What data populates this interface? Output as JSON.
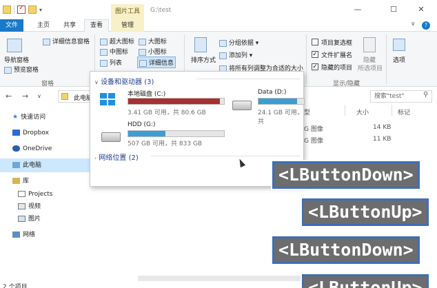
{
  "window": {
    "context_tab_header": "图片工具",
    "path_title": "G:\\test",
    "controls": [
      "—",
      "☐",
      "✕"
    ]
  },
  "tabs": {
    "file": "文件",
    "home": "主页",
    "share": "共享",
    "view": "查看",
    "manage": "管理",
    "help": "?"
  },
  "ribbon": {
    "pane_group": {
      "nav_pane": "导航窗格",
      "preview_pane": "预览窗格",
      "details_pane": "详细信息窗格",
      "label": "窗格"
    },
    "layout": {
      "extra_large": "超大图标",
      "large": "大图标",
      "medium": "中图标",
      "small": "小图标",
      "list": "列表",
      "details": "详细信息"
    },
    "current_view": {
      "sort": "排序方式",
      "group_by": "分组依据",
      "add_column": "添加列",
      "size_all": "将所有列调整为合适的大小"
    },
    "show_hide": {
      "item_checkboxes": "项目复选框",
      "file_extensions": "文件扩展名",
      "hidden_items": "隐藏的项目",
      "hide_selected_line1": "隐藏",
      "hide_selected_line2": "所选项目",
      "options": "选项",
      "label": "显示/隐藏"
    }
  },
  "navbar": {
    "back": "←",
    "forward": "→",
    "up_chevron": "∨",
    "breadcrumb": "此电脑",
    "search_placeholder": "搜索\"test\""
  },
  "sidebar": {
    "items": [
      {
        "label": "快速访问"
      },
      {
        "label": "Dropbox"
      },
      {
        "label": "OneDrive"
      },
      {
        "label": "此电脑"
      },
      {
        "label": "库"
      },
      {
        "label": "Projects"
      },
      {
        "label": "视频"
      },
      {
        "label": "图片"
      },
      {
        "label": "网络"
      }
    ]
  },
  "file_list": {
    "headers": {
      "type": "型",
      "size": "大小",
      "tags": "标记"
    },
    "rows": [
      {
        "type": "G 图像",
        "size": "14 KB"
      },
      {
        "type": "G 图像",
        "size": "11 KB"
      }
    ]
  },
  "dropdown": {
    "devices_header": "设备和驱动器 (3)",
    "network_header": "网络位置 (2)",
    "drives": [
      {
        "name": "本地磁盘 (C:)",
        "info": "3.41 GB 可用，共 80.6 GB",
        "used_fraction": 0.96,
        "bar_color": "#a93030"
      },
      {
        "name": "Data (D:)",
        "info": "24.1 GB 可用，共",
        "used_fraction": 0.85,
        "bar_color": "#3c9cd3"
      },
      {
        "name": "HDD (G:)",
        "info": "507 GB 可用，共 833 GB",
        "used_fraction": 0.39,
        "bar_color": "#3c9cd3"
      }
    ]
  },
  "overlays": {
    "l1": "<LButtonDown>",
    "l2": "<LButtonUp>",
    "l3": "<LButtonDown>",
    "l4": "<LButtonUp>"
  },
  "status": {
    "item_count": "2 个项目"
  }
}
